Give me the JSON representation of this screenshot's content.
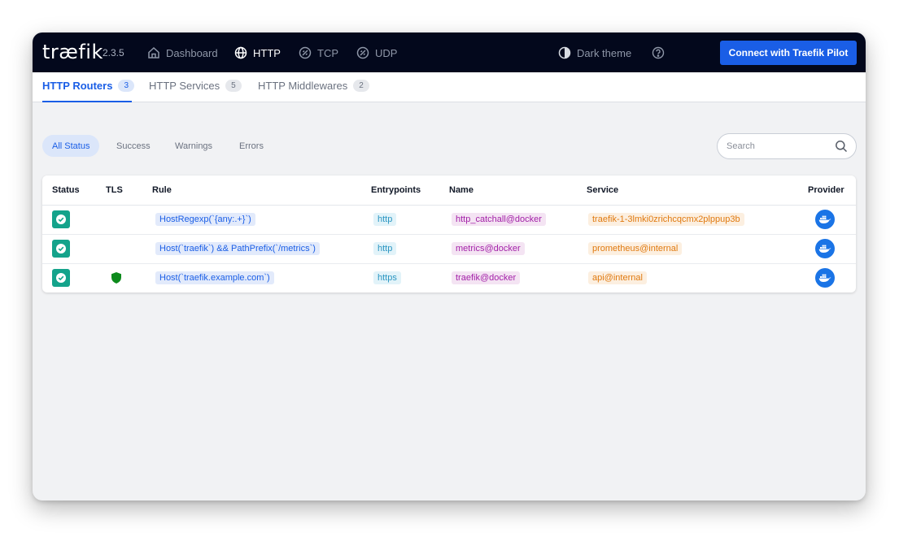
{
  "app": {
    "logo": "træfik",
    "version": "2.3.5"
  },
  "topnav": {
    "dashboard": "Dashboard",
    "http": "HTTP",
    "tcp": "TCP",
    "udp": "UDP",
    "dark_theme": "Dark theme",
    "connect_button": "Connect with Traefik Pilot"
  },
  "subnav": {
    "tabs": [
      {
        "label": "HTTP Routers",
        "count": "3"
      },
      {
        "label": "HTTP Services",
        "count": "5"
      },
      {
        "label": "HTTP Middlewares",
        "count": "2"
      }
    ]
  },
  "filters": {
    "all": "All Status",
    "success": "Success",
    "warnings": "Warnings",
    "errors": "Errors"
  },
  "search": {
    "placeholder": "Search"
  },
  "table": {
    "headers": {
      "status": "Status",
      "tls": "TLS",
      "rule": "Rule",
      "entrypoints": "Entrypoints",
      "name": "Name",
      "service": "Service",
      "provider": "Provider"
    },
    "rows": [
      {
        "rule": "HostRegexp(`{any:.+}`)",
        "entrypoints": "http",
        "name": "http_catchall@docker",
        "service": "traefik-1-3lmki0zrichcqcmx2plppup3b",
        "tls": false
      },
      {
        "rule": "Host(`traefik`) && PathPrefix(`/metrics`)",
        "entrypoints": "http",
        "name": "metrics@docker",
        "service": "prometheus@internal",
        "tls": false
      },
      {
        "rule": "Host(`traefik.example.com`)",
        "entrypoints": "https",
        "name": "traefik@docker",
        "service": "api@internal",
        "tls": true
      }
    ]
  },
  "colors": {
    "topbar": "#03081c",
    "accent": "#1a5ee6",
    "success": "#14a38b",
    "tls_shield": "#0d8a1c"
  },
  "icons": {
    "nav": [
      "home-icon",
      "globe-icon",
      "tcp-icon",
      "udp-icon",
      "theme-icon",
      "help-icon"
    ],
    "status": "check-icon",
    "tls": "shield-icon",
    "provider": "docker-icon",
    "search": "search-icon"
  }
}
